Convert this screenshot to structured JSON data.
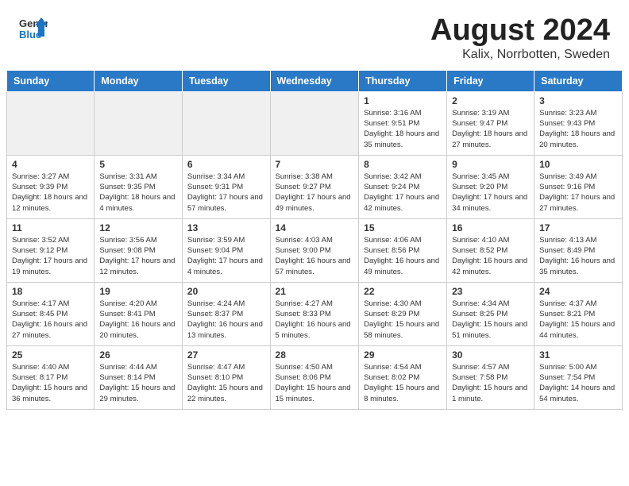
{
  "header": {
    "logo_line1": "General",
    "logo_line2": "Blue",
    "month_year": "August 2024",
    "location": "Kalix, Norrbotten, Sweden"
  },
  "weekdays": [
    "Sunday",
    "Monday",
    "Tuesday",
    "Wednesday",
    "Thursday",
    "Friday",
    "Saturday"
  ],
  "weeks": [
    [
      {
        "day": "",
        "info": ""
      },
      {
        "day": "",
        "info": ""
      },
      {
        "day": "",
        "info": ""
      },
      {
        "day": "",
        "info": ""
      },
      {
        "day": "1",
        "info": "Sunrise: 3:16 AM\nSunset: 9:51 PM\nDaylight: 18 hours and 35 minutes."
      },
      {
        "day": "2",
        "info": "Sunrise: 3:19 AM\nSunset: 9:47 PM\nDaylight: 18 hours and 27 minutes."
      },
      {
        "day": "3",
        "info": "Sunrise: 3:23 AM\nSunset: 9:43 PM\nDaylight: 18 hours and 20 minutes."
      }
    ],
    [
      {
        "day": "4",
        "info": "Sunrise: 3:27 AM\nSunset: 9:39 PM\nDaylight: 18 hours and 12 minutes."
      },
      {
        "day": "5",
        "info": "Sunrise: 3:31 AM\nSunset: 9:35 PM\nDaylight: 18 hours and 4 minutes."
      },
      {
        "day": "6",
        "info": "Sunrise: 3:34 AM\nSunset: 9:31 PM\nDaylight: 17 hours and 57 minutes."
      },
      {
        "day": "7",
        "info": "Sunrise: 3:38 AM\nSunset: 9:27 PM\nDaylight: 17 hours and 49 minutes."
      },
      {
        "day": "8",
        "info": "Sunrise: 3:42 AM\nSunset: 9:24 PM\nDaylight: 17 hours and 42 minutes."
      },
      {
        "day": "9",
        "info": "Sunrise: 3:45 AM\nSunset: 9:20 PM\nDaylight: 17 hours and 34 minutes."
      },
      {
        "day": "10",
        "info": "Sunrise: 3:49 AM\nSunset: 9:16 PM\nDaylight: 17 hours and 27 minutes."
      }
    ],
    [
      {
        "day": "11",
        "info": "Sunrise: 3:52 AM\nSunset: 9:12 PM\nDaylight: 17 hours and 19 minutes."
      },
      {
        "day": "12",
        "info": "Sunrise: 3:56 AM\nSunset: 9:08 PM\nDaylight: 17 hours and 12 minutes."
      },
      {
        "day": "13",
        "info": "Sunrise: 3:59 AM\nSunset: 9:04 PM\nDaylight: 17 hours and 4 minutes."
      },
      {
        "day": "14",
        "info": "Sunrise: 4:03 AM\nSunset: 9:00 PM\nDaylight: 16 hours and 57 minutes."
      },
      {
        "day": "15",
        "info": "Sunrise: 4:06 AM\nSunset: 8:56 PM\nDaylight: 16 hours and 49 minutes."
      },
      {
        "day": "16",
        "info": "Sunrise: 4:10 AM\nSunset: 8:52 PM\nDaylight: 16 hours and 42 minutes."
      },
      {
        "day": "17",
        "info": "Sunrise: 4:13 AM\nSunset: 8:49 PM\nDaylight: 16 hours and 35 minutes."
      }
    ],
    [
      {
        "day": "18",
        "info": "Sunrise: 4:17 AM\nSunset: 8:45 PM\nDaylight: 16 hours and 27 minutes."
      },
      {
        "day": "19",
        "info": "Sunrise: 4:20 AM\nSunset: 8:41 PM\nDaylight: 16 hours and 20 minutes."
      },
      {
        "day": "20",
        "info": "Sunrise: 4:24 AM\nSunset: 8:37 PM\nDaylight: 16 hours and 13 minutes."
      },
      {
        "day": "21",
        "info": "Sunrise: 4:27 AM\nSunset: 8:33 PM\nDaylight: 16 hours and 5 minutes."
      },
      {
        "day": "22",
        "info": "Sunrise: 4:30 AM\nSunset: 8:29 PM\nDaylight: 15 hours and 58 minutes."
      },
      {
        "day": "23",
        "info": "Sunrise: 4:34 AM\nSunset: 8:25 PM\nDaylight: 15 hours and 51 minutes."
      },
      {
        "day": "24",
        "info": "Sunrise: 4:37 AM\nSunset: 8:21 PM\nDaylight: 15 hours and 44 minutes."
      }
    ],
    [
      {
        "day": "25",
        "info": "Sunrise: 4:40 AM\nSunset: 8:17 PM\nDaylight: 15 hours and 36 minutes."
      },
      {
        "day": "26",
        "info": "Sunrise: 4:44 AM\nSunset: 8:14 PM\nDaylight: 15 hours and 29 minutes."
      },
      {
        "day": "27",
        "info": "Sunrise: 4:47 AM\nSunset: 8:10 PM\nDaylight: 15 hours and 22 minutes."
      },
      {
        "day": "28",
        "info": "Sunrise: 4:50 AM\nSunset: 8:06 PM\nDaylight: 15 hours and 15 minutes."
      },
      {
        "day": "29",
        "info": "Sunrise: 4:54 AM\nSunset: 8:02 PM\nDaylight: 15 hours and 8 minutes."
      },
      {
        "day": "30",
        "info": "Sunrise: 4:57 AM\nSunset: 7:58 PM\nDaylight: 15 hours and 1 minute."
      },
      {
        "day": "31",
        "info": "Sunrise: 5:00 AM\nSunset: 7:54 PM\nDaylight: 14 hours and 54 minutes."
      }
    ]
  ]
}
